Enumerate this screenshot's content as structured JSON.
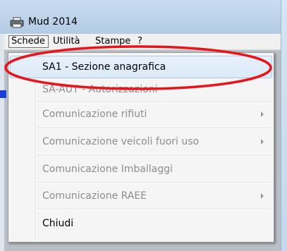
{
  "window": {
    "title": "Mud 2014",
    "icon": "printer-app-icon"
  },
  "menubar": {
    "items": [
      {
        "label": "Schede",
        "active": true
      },
      {
        "label": "Utilità",
        "active": false
      },
      {
        "label": "Stampe",
        "active": false
      },
      {
        "label": "?",
        "active": false
      }
    ]
  },
  "dropdown": {
    "items": [
      {
        "label": "SA1 - Sezione anagrafica",
        "enabled": true,
        "submenu": false,
        "highlighted": true
      },
      {
        "label": "SA-AUT - Autorizzazioni",
        "enabled": false,
        "submenu": false
      },
      {
        "label": "Comunicazione rifiuti",
        "enabled": false,
        "submenu": true
      },
      {
        "label": "Comunicazione veicoli fuori uso",
        "enabled": false,
        "submenu": true
      },
      {
        "label": "Comunicazione Imballaggi",
        "enabled": false,
        "submenu": false
      },
      {
        "label": "Comunicazione RAEE",
        "enabled": false,
        "submenu": true
      },
      {
        "label": "Chiudi",
        "enabled": true,
        "submenu": false
      }
    ]
  },
  "colors": {
    "annotation": "#e8141c",
    "accent_square": "#1a3fd6",
    "highlight_border": "#a9c8ea"
  }
}
